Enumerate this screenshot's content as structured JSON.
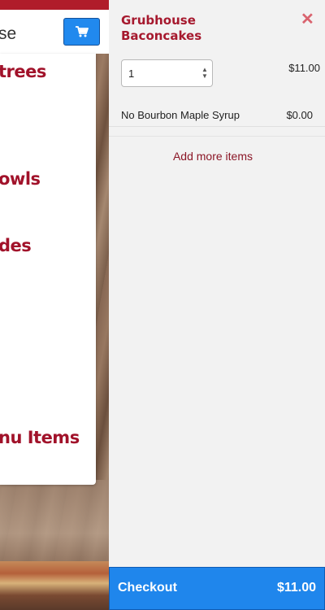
{
  "header": {
    "title_fragment": "se",
    "cart_icon": "shopping-cart-icon"
  },
  "menu": {
    "categories": [
      "trees",
      "owls",
      "des",
      "nu Items"
    ]
  },
  "cart": {
    "item": {
      "name_line1": "Grubhouse",
      "name_line2": "Baconcakes",
      "quantity": "1",
      "price": "$11.00"
    },
    "options": [
      {
        "label": "No Bourbon Maple Syrup",
        "price": "$0.00"
      }
    ],
    "add_more_label": "Add more items",
    "close_glyph": "✕",
    "checkout": {
      "label": "Checkout",
      "total": "$11.00"
    }
  },
  "colors": {
    "brand_red": "#a6192e",
    "checkout_blue": "#1f86ec"
  }
}
